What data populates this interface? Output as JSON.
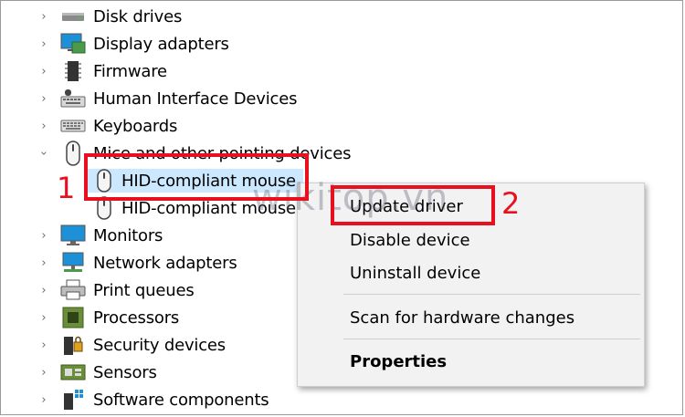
{
  "tree": {
    "categories_before": [
      {
        "label": "Disk drives",
        "icon": "disk-drive-icon"
      },
      {
        "label": "Display adapters",
        "icon": "display-adapter-icon"
      },
      {
        "label": "Firmware",
        "icon": "firmware-icon"
      },
      {
        "label": "Human Interface Devices",
        "icon": "hid-icon"
      },
      {
        "label": "Keyboards",
        "icon": "keyboard-icon"
      }
    ],
    "expanded_category": {
      "label": "Mice and other pointing devices",
      "icon": "mouse-icon"
    },
    "children": [
      {
        "label": "HID-compliant mouse",
        "selected": true
      },
      {
        "label": "HID-compliant mouse",
        "selected": false
      }
    ],
    "categories_after": [
      {
        "label": "Monitors",
        "icon": "monitor-icon"
      },
      {
        "label": "Network adapters",
        "icon": "network-adapter-icon"
      },
      {
        "label": "Print queues",
        "icon": "printer-icon"
      },
      {
        "label": "Processors",
        "icon": "processor-icon"
      },
      {
        "label": "Security devices",
        "icon": "security-device-icon"
      },
      {
        "label": "Sensors",
        "icon": "sensor-icon"
      },
      {
        "label": "Software components",
        "icon": "software-component-icon"
      }
    ]
  },
  "context_menu": {
    "update_driver": "Update driver",
    "disable_device": "Disable device",
    "uninstall_device": "Uninstall device",
    "scan_hardware": "Scan for hardware changes",
    "properties": "Properties"
  },
  "annotations": {
    "step1": "1",
    "step2": "2"
  },
  "watermark": "wikitop.vn",
  "colors": {
    "selection": "#cce8ff",
    "callout": "#e8101e",
    "menu_bg": "#f2f2f2"
  }
}
